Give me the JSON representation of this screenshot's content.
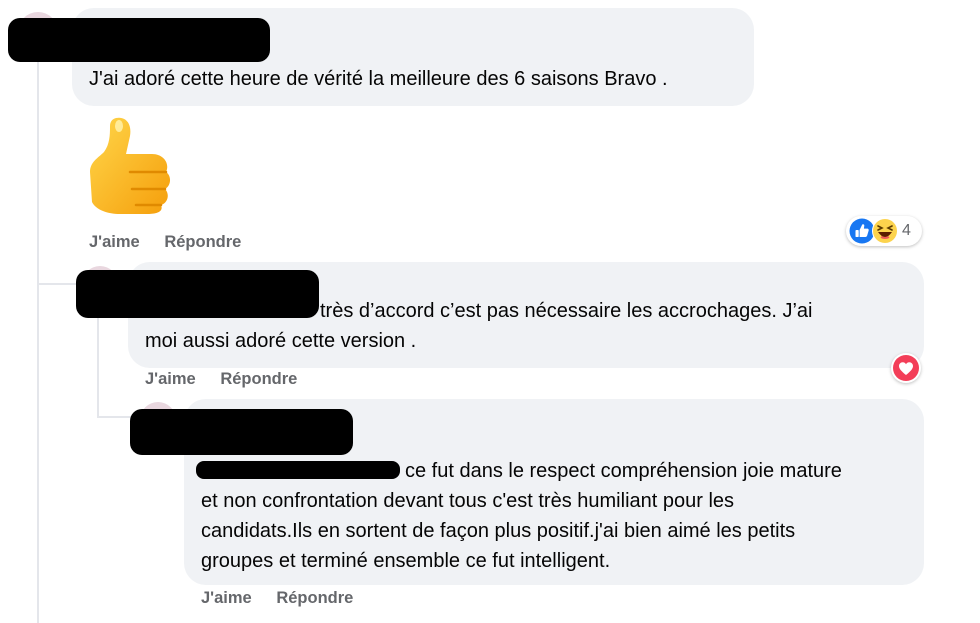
{
  "comments": [
    {
      "text": "J'ai adoré cette heure de vérité la meilleure des 6 saisons Bravo .",
      "sticker": "thumbs-up-sticker",
      "actions": {
        "like": "J'aime",
        "reply": "Répondre"
      },
      "reactions": {
        "icons": [
          "like-icon",
          "laugh-icon"
        ],
        "count": "4"
      }
    },
    {
      "text_line1": "très d’accord c’est pas nécessaire les accrochages. J’ai",
      "text_line2": "moi aussi adoré cette version .",
      "actions": {
        "like": "J'aime",
        "reply": "Répondre"
      },
      "reactions": {
        "icons": [
          "heart-icon"
        ]
      }
    },
    {
      "text_line1": "ce fut dans le respect compréhension joie mature",
      "text_line2": "et non confrontation devant tous c'est très humiliant pour les",
      "text_line3": "candidats.Ils en sortent de façon plus positif.j'ai bien aimé les petits",
      "text_line4": "groupes et terminé ensemble ce fut intelligent.",
      "actions": {
        "like": "J'aime",
        "reply": "Répondre"
      }
    }
  ],
  "colors": {
    "bubble": "#f0f2f5",
    "action_text": "#65676b",
    "like_blue": "#1877f2",
    "heart_red": "#f33e58"
  }
}
